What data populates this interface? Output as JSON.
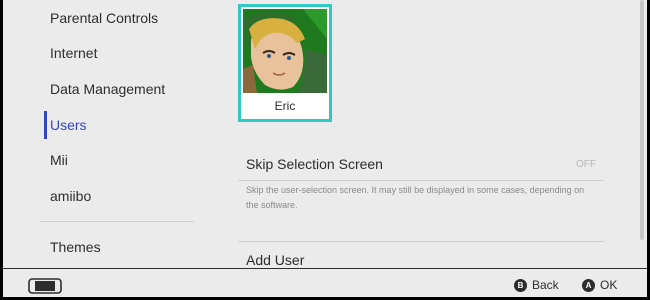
{
  "sidebar": {
    "items": [
      {
        "label": "Parental Controls"
      },
      {
        "label": "Internet"
      },
      {
        "label": "Data Management"
      },
      {
        "label": "Users",
        "active": true
      },
      {
        "label": "Mii"
      },
      {
        "label": "amiibo"
      },
      {
        "label": "Themes"
      }
    ]
  },
  "main": {
    "user": {
      "name": "Eric",
      "avatar_icon": "link-avatar-icon"
    },
    "skip_selection": {
      "label": "Skip Selection Screen",
      "value": "OFF",
      "description": "Skip the user-selection screen. It may still be displayed in some cases, depending on the software."
    },
    "add_user": {
      "label": "Add User"
    }
  },
  "footer": {
    "console_icon": "console-icon",
    "back": {
      "button": "B",
      "label": "Back"
    },
    "ok": {
      "button": "A",
      "label": "OK"
    }
  },
  "colors": {
    "accent": "#3246c8",
    "selection_border": "#2ec9c1",
    "background": "#ebebeb"
  }
}
